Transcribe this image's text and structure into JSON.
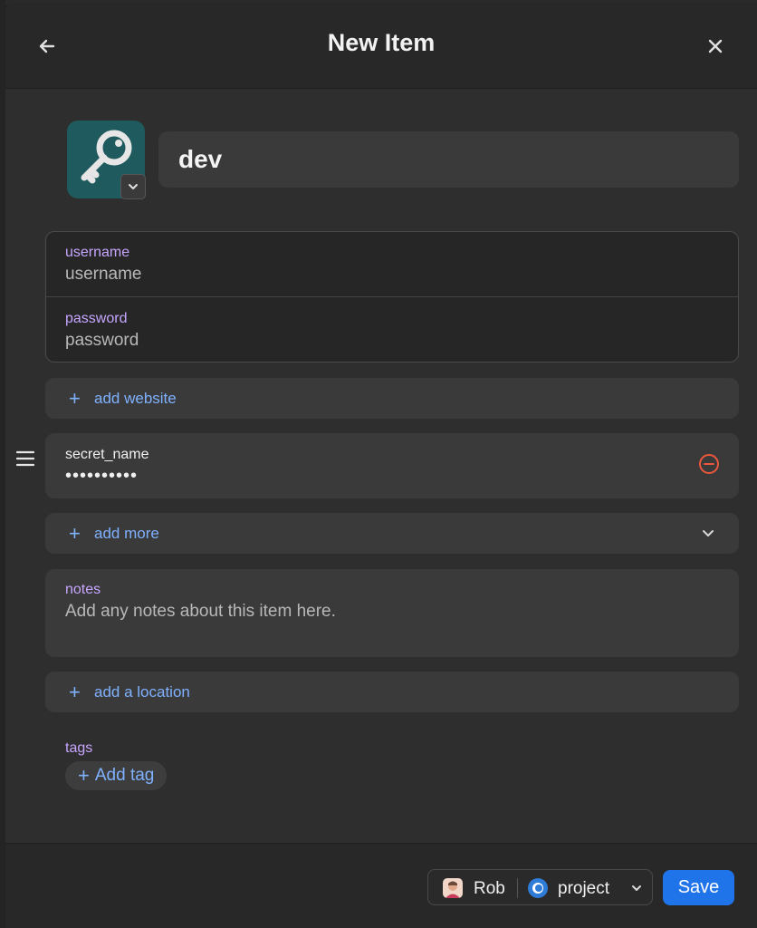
{
  "header": {
    "title": "New Item",
    "back_icon": "arrow-left-icon",
    "close_icon": "close-icon"
  },
  "item": {
    "icon": "key-icon",
    "icon_color": "#1f5a5e",
    "name": "dev"
  },
  "credentials": {
    "username": {
      "label": "username",
      "placeholder": "username"
    },
    "password": {
      "label": "password",
      "placeholder": "password"
    }
  },
  "add_website": {
    "label": "add website"
  },
  "custom_field": {
    "label": "secret_name",
    "value": "••••••••••"
  },
  "add_more": {
    "label": "add more"
  },
  "notes": {
    "label": "notes",
    "placeholder": "Add any notes about this item here."
  },
  "add_location": {
    "label": "add a location"
  },
  "tags": {
    "label": "tags",
    "add_label": "Add tag"
  },
  "footer": {
    "owner": "Rob",
    "vault": "project",
    "save_label": "Save"
  },
  "colors": {
    "accent": "#1f74ea",
    "link": "#7fb1ff",
    "label": "#c7a6ff",
    "danger": "#e9573d"
  }
}
